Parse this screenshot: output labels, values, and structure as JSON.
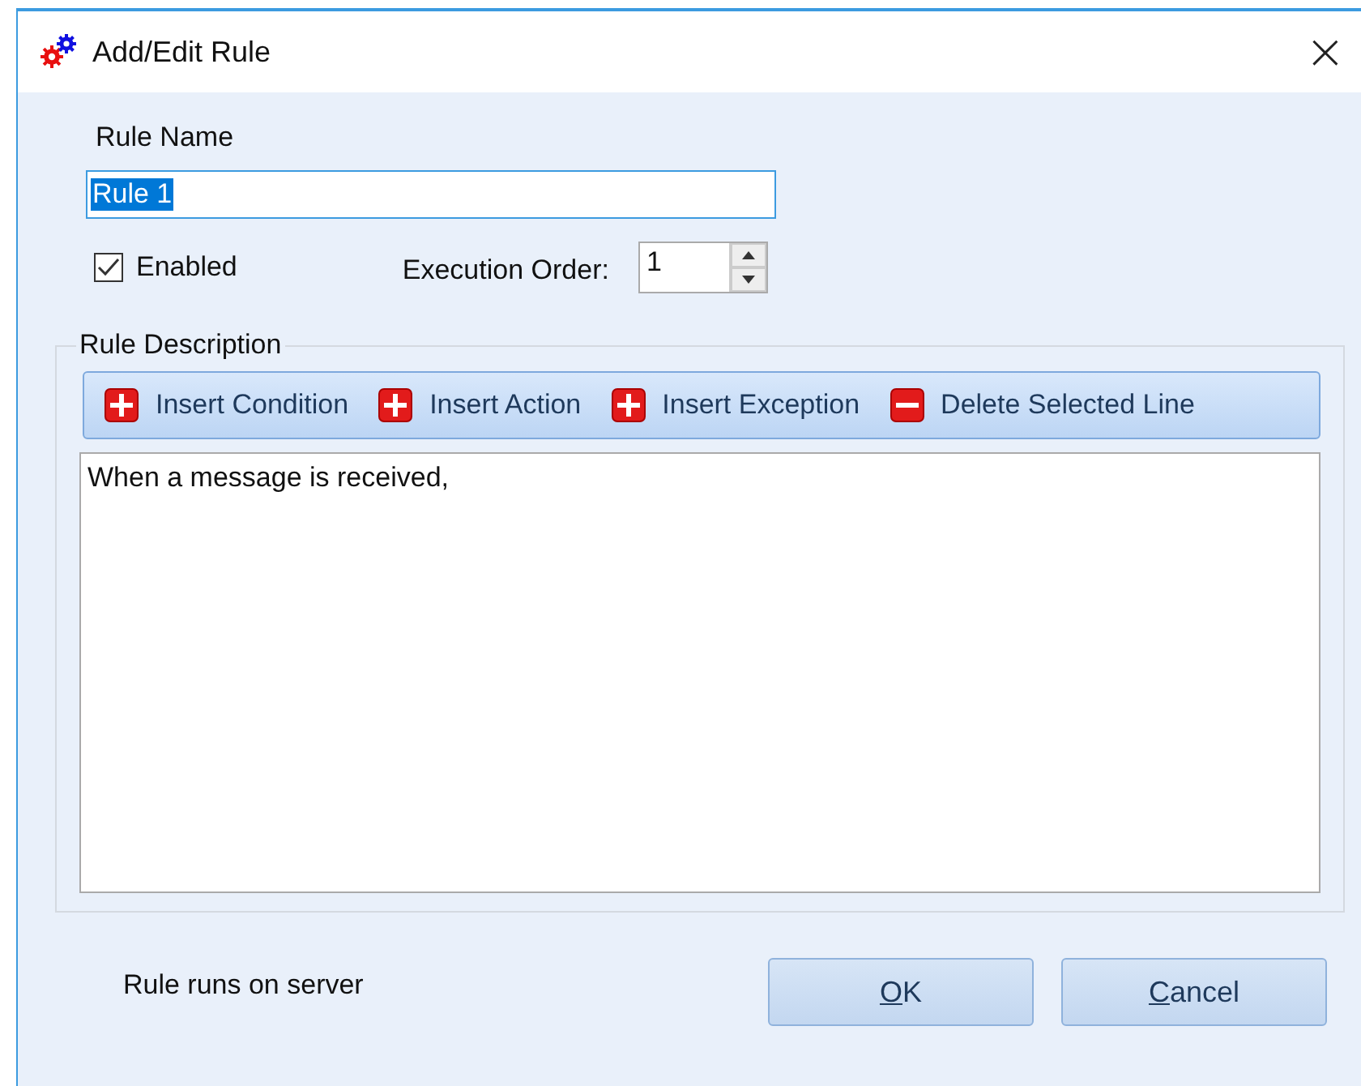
{
  "window": {
    "title": "Add/Edit Rule",
    "close": "×"
  },
  "rule_name": {
    "label": "Rule Name",
    "value": "Rule 1",
    "selected": true
  },
  "enabled": {
    "label": "Enabled",
    "checked": true
  },
  "execution_order": {
    "label": "Execution Order:",
    "value": "1"
  },
  "rule_description": {
    "label": "Rule Description",
    "toolbar": [
      {
        "label": "Insert Condition",
        "kind": "insert"
      },
      {
        "label": "Insert Action",
        "kind": "insert"
      },
      {
        "label": "Insert Exception",
        "kind": "insert"
      },
      {
        "label": "Delete Selected Line",
        "kind": "delete"
      }
    ],
    "text": "When a message is received,"
  },
  "status": "Rule runs on server",
  "buttons": [
    {
      "key": "O",
      "rest": "K"
    },
    {
      "key": "C",
      "rest": "ancel"
    }
  ]
}
